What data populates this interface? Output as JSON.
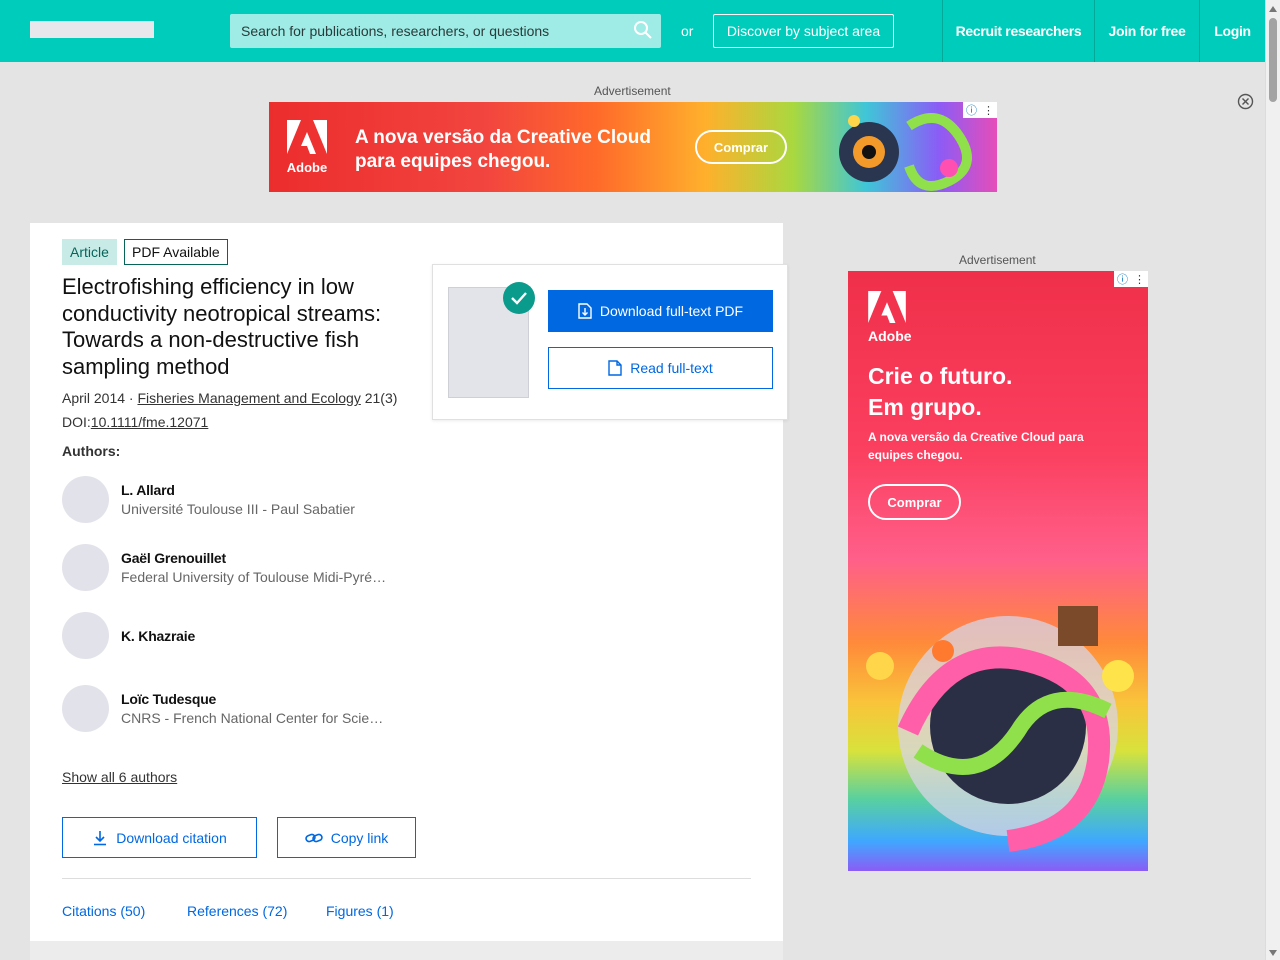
{
  "header": {
    "search_placeholder": "Search for publications, researchers, or questions",
    "or_label": "or",
    "discover_label": "Discover by subject area",
    "nav": [
      {
        "label": "Recruit researchers"
      },
      {
        "label": "Join for free"
      },
      {
        "label": "Login"
      }
    ]
  },
  "ads": {
    "label": "Advertisement",
    "banner": {
      "brand": "Adobe",
      "text_line1": "A nova versão da Creative Cloud",
      "text_line2": "para equipes chegou.",
      "cta": "Comprar"
    },
    "side": {
      "brand": "Adobe",
      "headline_line1": "Crie o futuro.",
      "headline_line2": "Em grupo.",
      "subtext": "A nova versão da Creative Cloud para equipes chegou.",
      "cta": "Comprar"
    }
  },
  "article": {
    "type_tag": "Article",
    "pdf_tag": "PDF Available",
    "title": "Electrofishing efficiency in low conductivity neotropical streams: Towards a non-destructive fish sampling method",
    "date": "April 2014 · ",
    "journal": "Fisheries Management and Ecology",
    "volume": " 21(3)",
    "doi_prefix": "DOI:",
    "doi": "10.1111/fme.12071",
    "authors_label": "Authors:",
    "authors": [
      {
        "name": "L. Allard",
        "affiliation": "Université Toulouse III - Paul Sabatier"
      },
      {
        "name": "Gaël Grenouillet",
        "affiliation": "Federal University of Toulouse Midi-Pyrénées"
      },
      {
        "name": "K. Khazraie",
        "affiliation": ""
      },
      {
        "name": "Loïc Tudesque",
        "affiliation": "CNRS - French National Center for Scientific Research"
      }
    ],
    "show_all": "Show all 6 authors",
    "download_citation": "Download citation",
    "copy_link": "Copy link",
    "tabs": [
      {
        "label": "Citations (50)"
      },
      {
        "label": "References (72)"
      },
      {
        "label": "Figures (1)"
      }
    ]
  },
  "pdf_panel": {
    "download_label": "Download full-text PDF",
    "read_label": "Read full-text"
  },
  "colors": {
    "brand_teal": "#00ccbb",
    "link_blue": "#0068e0",
    "check_green": "#0a9b8c"
  }
}
